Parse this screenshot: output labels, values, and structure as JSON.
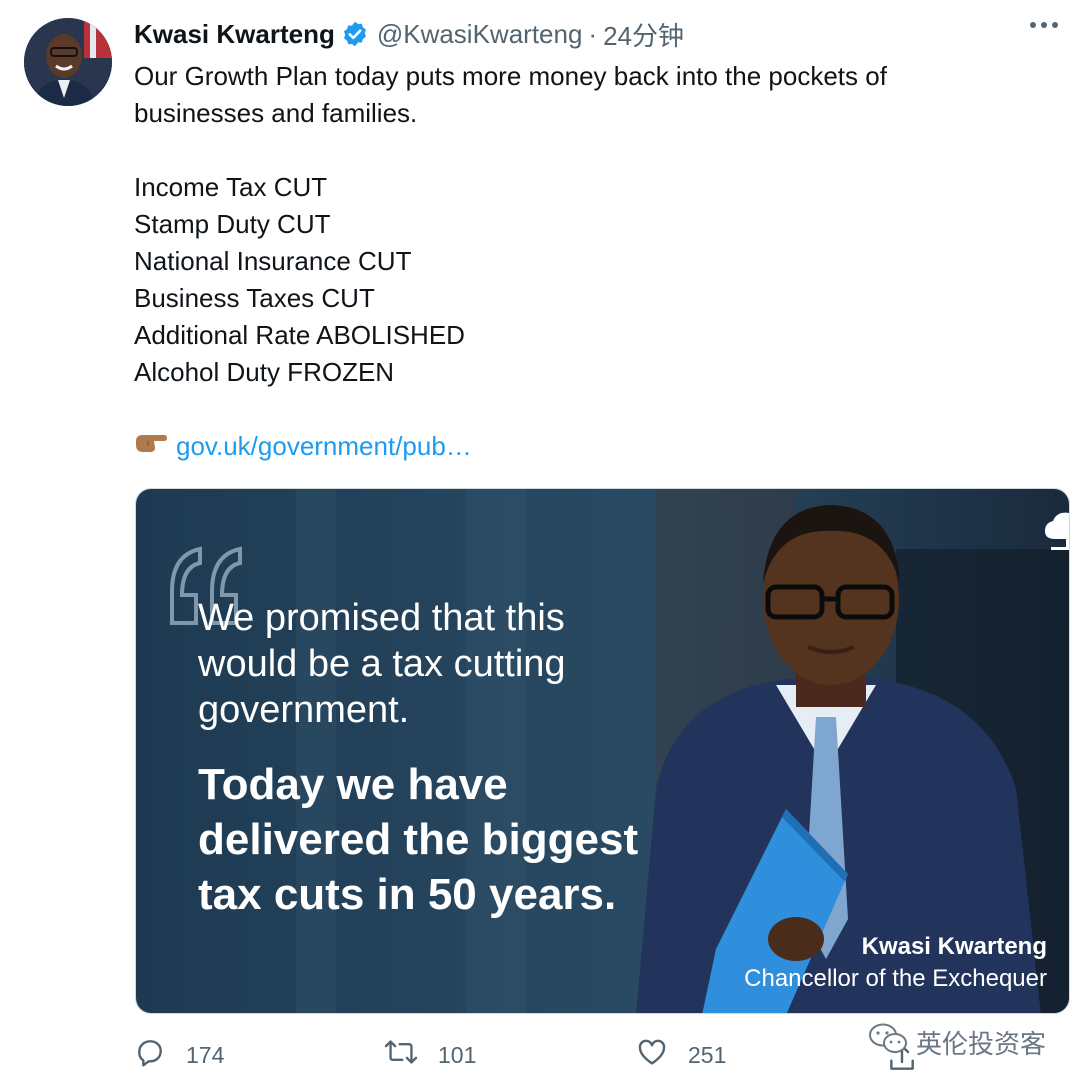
{
  "author": {
    "name": "Kwasi Kwarteng",
    "handle": "@KwasiKwarteng",
    "separator": "·",
    "time": "24分钟"
  },
  "tweet": {
    "lines": [
      "Our Growth Plan today puts more money back into the pockets of",
      "businesses and families.",
      "",
      "Income Tax CUT",
      "Stamp Duty CUT",
      "National Insurance CUT",
      "Business Taxes CUT",
      "Additional Rate ABOLISHED",
      "Alcohol Duty FROZEN",
      ""
    ],
    "link_emoji": "👉🏽",
    "link_text": "gov.uk/government/pub…"
  },
  "media": {
    "quote_light": [
      "We promised that this",
      "would be a tax cutting",
      "government."
    ],
    "quote_bold": [
      "Today we have",
      "delivered the biggest",
      "tax cuts in 50 years."
    ],
    "caption_name": "Kwasi Kwarteng",
    "caption_role": "Chancellor of the Exchequer"
  },
  "actions": {
    "replies": "174",
    "retweets": "101",
    "likes": "251"
  },
  "watermark": "英伦投资客",
  "colors": {
    "text": "#0f1419",
    "muted": "#536471",
    "link": "#1d9bf0",
    "verified": "#1d9bf0",
    "media_bg": "#1e3a52"
  },
  "icons": [
    "verified-badge-icon",
    "more-icon",
    "pointing-hand-emoji",
    "reply-icon",
    "retweet-icon",
    "like-icon",
    "share-icon",
    "wechat-icon",
    "oak-tree-logo"
  ]
}
